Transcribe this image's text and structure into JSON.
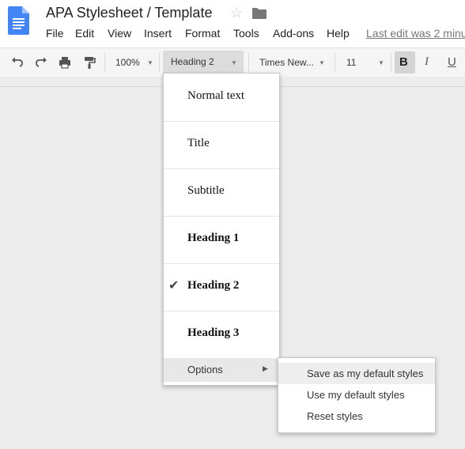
{
  "header": {
    "title": "APA Stylesheet / Template",
    "last_edit": "Last edit was 2 minu"
  },
  "menubar": [
    "File",
    "Edit",
    "View",
    "Insert",
    "Format",
    "Tools",
    "Add-ons",
    "Help"
  ],
  "toolbar": {
    "zoom": "100%",
    "style": "Heading 2",
    "font": "Times New...",
    "size": "11",
    "bold": "B",
    "italic": "I",
    "underline": "U"
  },
  "styles_menu": {
    "items": [
      {
        "label": "Normal text",
        "checked": false
      },
      {
        "label": "Title",
        "checked": false
      },
      {
        "label": "Subtitle",
        "checked": false
      },
      {
        "label": "Heading 1",
        "checked": false
      },
      {
        "label": "Heading 2",
        "checked": true
      },
      {
        "label": "Heading 3",
        "checked": false
      }
    ],
    "options_label": "Options"
  },
  "options_submenu": {
    "items": [
      "Save as my default styles",
      "Use my default styles",
      "Reset styles"
    ]
  },
  "colors": {
    "docs_blue": "#4285f4",
    "menu_highlight": "#eeeeee"
  }
}
